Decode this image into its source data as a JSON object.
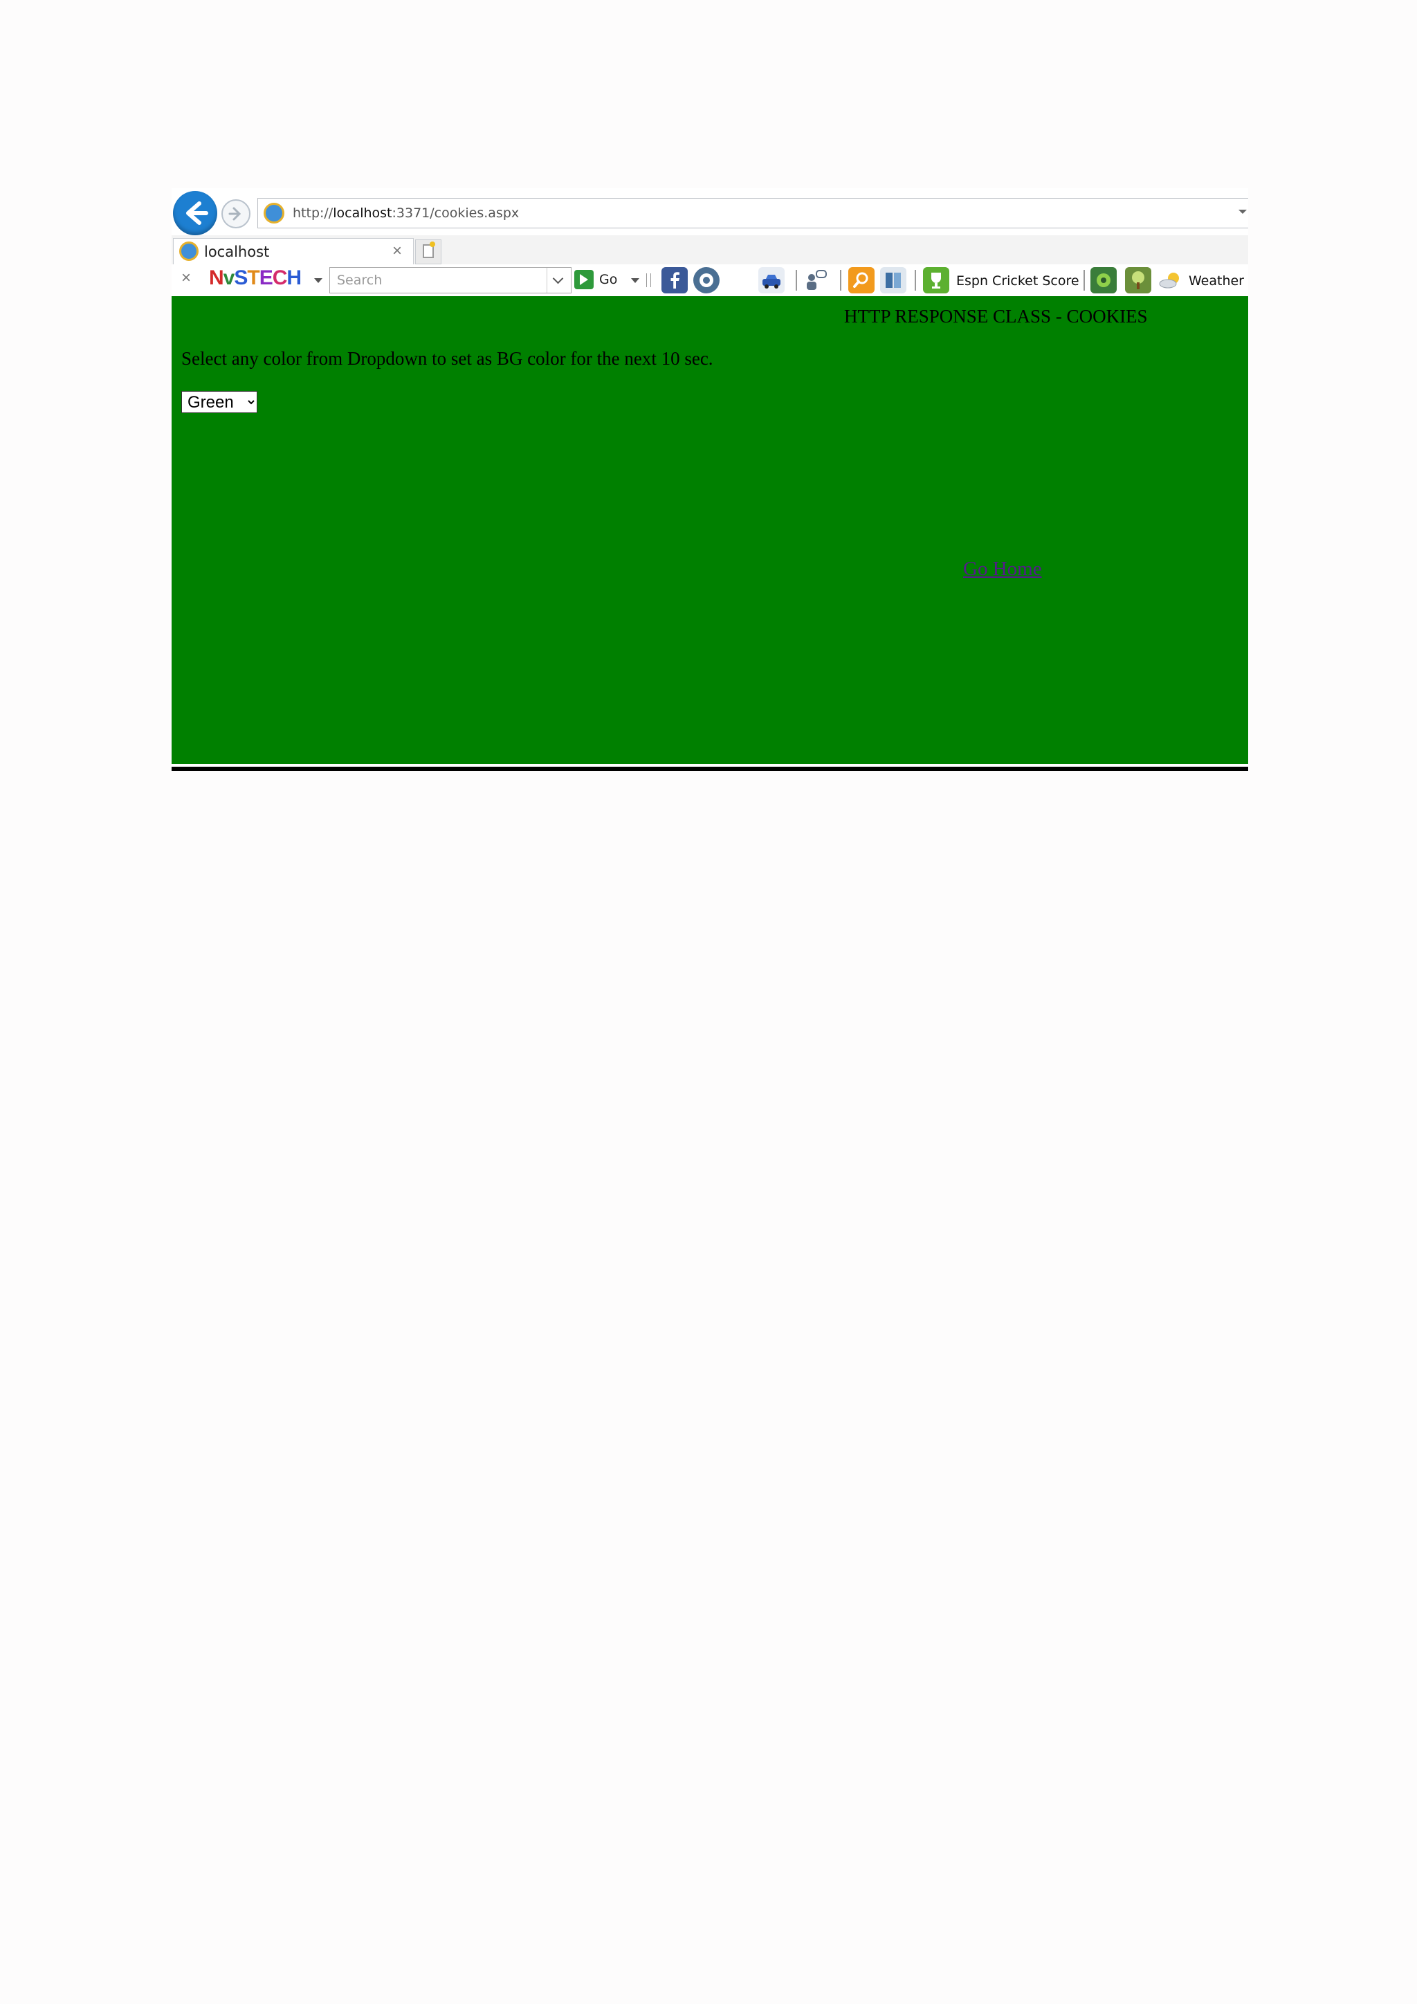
{
  "browser": {
    "url_prefix": "http://",
    "url_host": "localhost",
    "url_rest": ":3371/cookies.aspx",
    "tab_title": "localhost",
    "tab_close": "×",
    "toolbar_close": "×",
    "brand": {
      "n": "N",
      "v": "v",
      "s": "S",
      "t": "T",
      "e": "E",
      "c": "C",
      "h": "H"
    },
    "search_placeholder": "Search",
    "go_label": "Go",
    "espn_label": "Espn Cricket Score",
    "weather_label": "Weather"
  },
  "page": {
    "background_color": "#008000",
    "title": "HTTP RESPONSE CLASS - COOKIES",
    "instruction": "Select any color from Dropdown to set as BG color for the next 10 sec.",
    "selected_color": "Green",
    "go_home_label": "Go Home"
  },
  "colors": {
    "page_green": "#008000",
    "back_button_blue": "#1d7fd1",
    "visited_link": "#551a8b"
  }
}
